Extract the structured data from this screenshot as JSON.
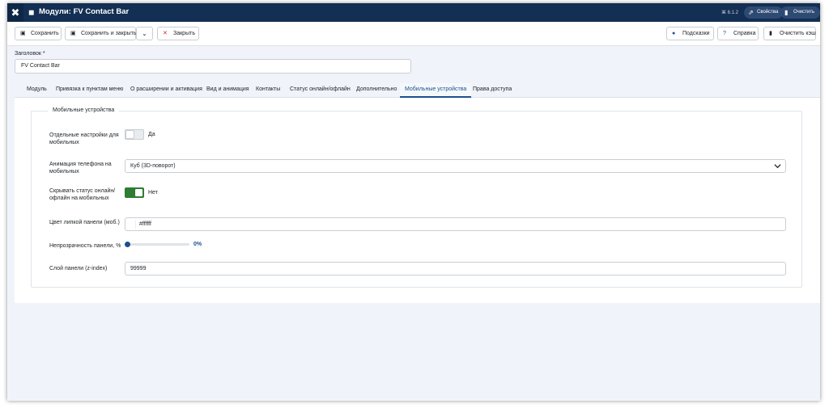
{
  "header": {
    "title": "Модули: FV Contact Bar",
    "version": "⌘ 6.1.2",
    "actions": [
      {
        "label": "Свойства",
        "icon": "external-link-icon"
      },
      {
        "label": "Очистить кэш",
        "icon": "trash-icon"
      }
    ]
  },
  "toolbar": {
    "save": "Сохранить",
    "save_close": "Сохранить и закрыть",
    "close": "Закрыть",
    "hints": "Подсказки",
    "help": "Справка",
    "clear_cache": "Очистить кэш"
  },
  "form": {
    "title_label": "Заголовок *",
    "title_value": "FV Contact Bar"
  },
  "tabs": [
    {
      "label": "Модуль",
      "active": false
    },
    {
      "label": "Привязка к пунктам меню",
      "active": false
    },
    {
      "label": "О расширении и активация",
      "active": false
    },
    {
      "label": "Вид и анимация",
      "active": false
    },
    {
      "label": "Контакты",
      "active": false
    },
    {
      "label": "Статус онлайн/офлайн",
      "active": false
    },
    {
      "label": "Дополнительно",
      "active": false
    },
    {
      "label": "Мобильные устройства",
      "active": true
    },
    {
      "label": "Права доступа",
      "active": false
    }
  ],
  "mobile": {
    "legend": "Мобильные устройства",
    "separate_label": "Отдельные настройки для мобильных",
    "separate_value": "Да",
    "separate_on": false,
    "animation_label": "Анимация телефона на мобильных",
    "animation_value": "Куб (3D-поворот)",
    "hide_status_label": "Скрывать статус онлайн/офлайн на мобильных",
    "hide_status_value": "Нет",
    "hide_status_on": true,
    "color_label": "Цвет липкой панели (моб.)",
    "color_value": "#ffffff",
    "opacity_label": "Непрозрачность панели, %",
    "opacity_value": "0%",
    "opacity_fraction": 0,
    "zindex_label": "Слой панели (z-index)",
    "zindex_value": "99999"
  },
  "colors": {
    "header_bg": "#132f53",
    "accent": "#1d4f91",
    "switch_on": "#2f7d32"
  }
}
